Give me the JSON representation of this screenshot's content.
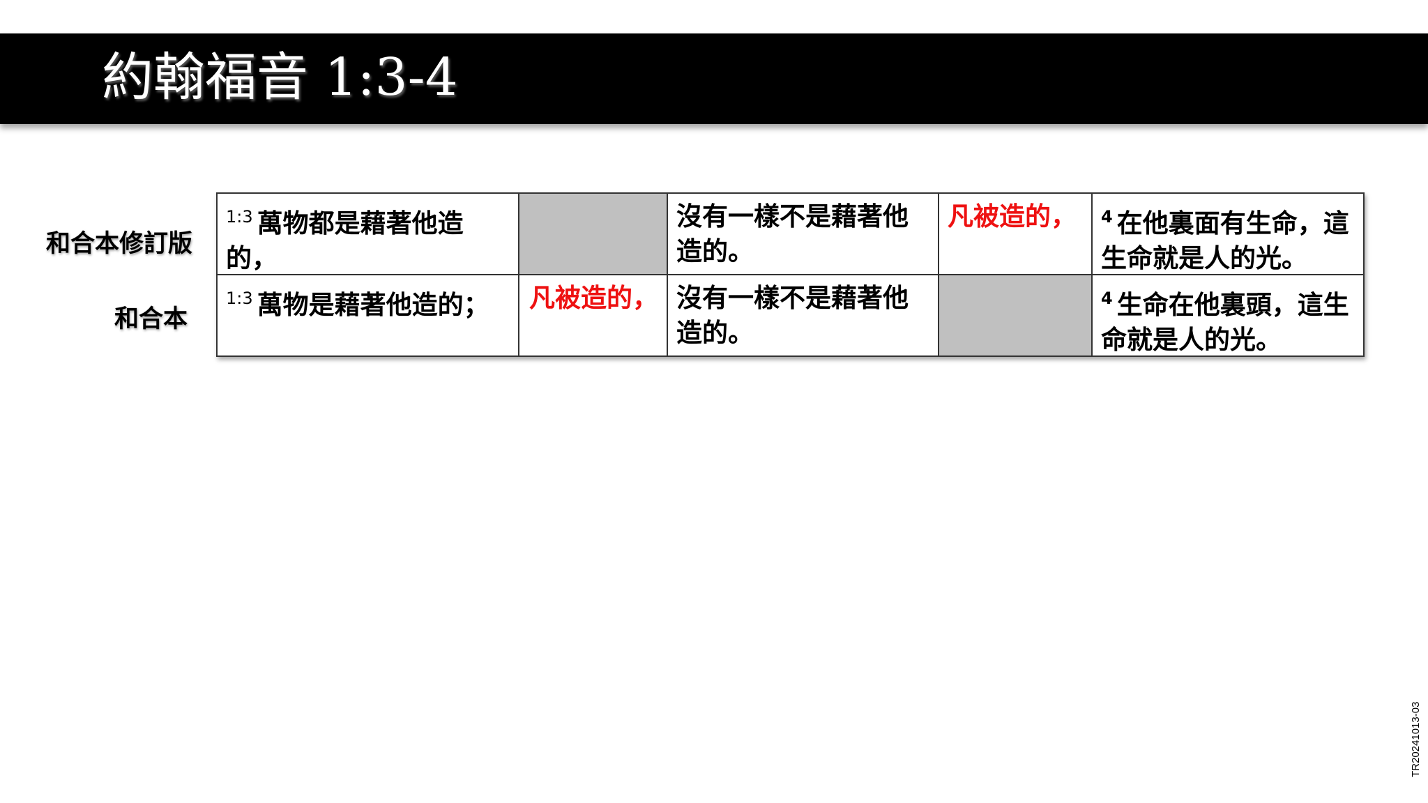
{
  "title": "約翰福音 1:3-4",
  "rows": [
    {
      "label": "和合本修訂版",
      "cells": [
        {
          "verse": "1:3",
          "text": "萬物都是藉著他造的，"
        },
        {
          "verse": "",
          "text": ""
        },
        {
          "verse": "",
          "text": "沒有一樣不是藉著他造的。"
        },
        {
          "verse": "",
          "text": "凡被造的，"
        },
        {
          "verse": "4",
          "text": "在他裏面有生命，這生命就是人的光。"
        }
      ]
    },
    {
      "label": "和合本",
      "cells": [
        {
          "verse": "1:3",
          "text": "萬物是藉著他造的；"
        },
        {
          "verse": "",
          "text": "凡被造的，"
        },
        {
          "verse": "",
          "text": "沒有一樣不是藉著他造的。"
        },
        {
          "verse": "",
          "text": ""
        },
        {
          "verse": "4",
          "text": "生命在他裏頭，這生命就是人的光。"
        }
      ]
    }
  ],
  "side_code": "TR20241013-03",
  "colors": {
    "title_bar": "#000000",
    "highlight_text": "#ee1111",
    "empty_cell": "#c0c0c0"
  }
}
